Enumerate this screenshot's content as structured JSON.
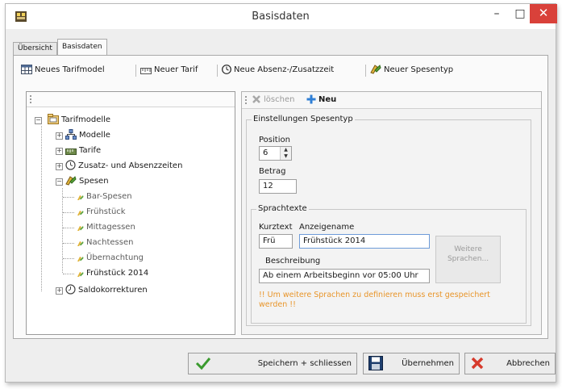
{
  "window": {
    "title": "Basisdaten",
    "controls": {
      "minimize": "–",
      "maximize": "□",
      "close": "✕"
    }
  },
  "tabs": [
    {
      "label": "Übersicht",
      "active": false
    },
    {
      "label": "Basisdaten",
      "active": true
    }
  ],
  "toolbar": {
    "new_tariff_model": "Neues Tarifmodel",
    "new_tariff": "Neuer Tarif",
    "new_absence": "Neue Absenz-/Zusatzzeit",
    "new_expense_type": "Neuer Spesentyp"
  },
  "tree": {
    "root": "Tarifmodelle",
    "models": "Modelle",
    "tariffs": "Tarife",
    "extra_absence": "Zusatz- und Absenzzeiten",
    "expenses": "Spesen",
    "expense_items": [
      "Bar-Spesen",
      "Frühstück",
      "Mittagessen",
      "Nachtessen",
      "Übernachtung",
      "Frühstück 2014"
    ],
    "balance_corrections": "Saldokorrekturen"
  },
  "detail_toolbar": {
    "delete": "löschen",
    "new": "Neu"
  },
  "settings": {
    "group_title": "Einstellungen Spesentyp",
    "position_label": "Position",
    "position_value": "6",
    "amount_label": "Betrag",
    "amount_value": "12"
  },
  "language_texts": {
    "group_title": "Sprachtexte",
    "short_label": "Kurztext",
    "display_label": "Anzeigename",
    "short_value": "Frü",
    "display_value": "Frühstück 2014",
    "description_label": "Beschreibung",
    "description_value": "Ab einem Arbeitsbeginn vor 05:00 Uhr",
    "more_languages_line1": "Weitere",
    "more_languages_line2": "Sprachen...",
    "warning_line1": "!! Um weitere Sprachen zu definieren muss erst gespeichert",
    "warning_line2": "werden !!"
  },
  "footer": {
    "save_close": "Speichern + schliessen",
    "apply": "Übernehmen",
    "cancel": "Abbrechen"
  },
  "colors": {
    "close_button": "#d9413a",
    "save_check": "#3a9a2e",
    "cancel_x": "#d63a2c",
    "warning_text": "#e8952a",
    "add_plus": "#2f7fd6"
  }
}
